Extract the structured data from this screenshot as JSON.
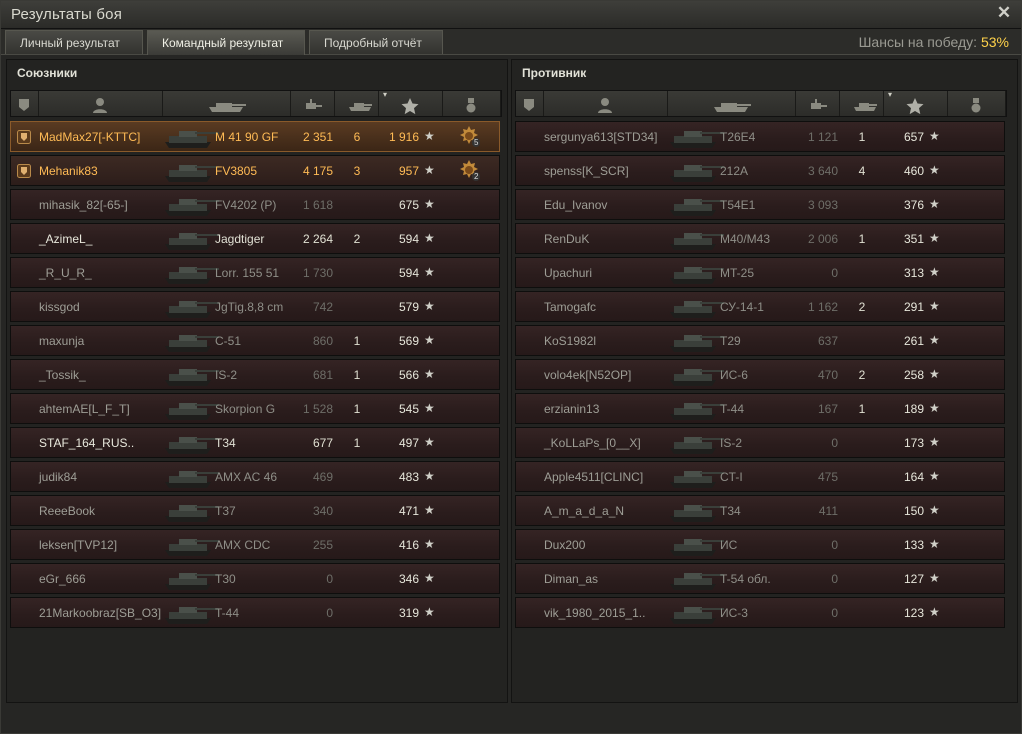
{
  "window": {
    "title": "Результаты боя"
  },
  "tabs": [
    {
      "label": "Личный результат",
      "active": false
    },
    {
      "label": "Командный результат",
      "active": true
    },
    {
      "label": "Подробный отчёт",
      "active": false
    }
  ],
  "win_chance": {
    "label": "Шансы на победу:",
    "value": "53%"
  },
  "allies": {
    "title": "Союзники",
    "rows": [
      {
        "nick": "MadMax27[-KTTC]",
        "vehicle": "M 41 90 GF",
        "damage": "2 351",
        "kills": "6",
        "xp": "1 916",
        "style": "self",
        "platoon": true,
        "medal": "5"
      },
      {
        "nick": "Mehanik83",
        "vehicle": "FV3805",
        "damage": "4 175",
        "kills": "3",
        "xp": "957",
        "style": "squad",
        "platoon": true,
        "medal": "2"
      },
      {
        "nick": "mihasik_82[-65-]",
        "vehicle": "FV4202 (P)",
        "damage": "1 618",
        "kills": "",
        "xp": "675",
        "style": "dead"
      },
      {
        "nick": "_AzimeL_",
        "vehicle": "Jagdtiger",
        "damage": "2 264",
        "kills": "2",
        "xp": "594",
        "style": "alive"
      },
      {
        "nick": "_R_U_R_",
        "vehicle": "Lorr. 155 51",
        "damage": "1 730",
        "kills": "",
        "xp": "594",
        "style": "dead"
      },
      {
        "nick": "kissgod",
        "vehicle": "JgTig.8,8 cm",
        "damage": "742",
        "kills": "",
        "xp": "579",
        "style": "dead"
      },
      {
        "nick": "maxunja",
        "vehicle": "C-51",
        "damage": "860",
        "kills": "1",
        "xp": "569",
        "style": "dead"
      },
      {
        "nick": "_Tossik_",
        "vehicle": "IS-2",
        "damage": "681",
        "kills": "1",
        "xp": "566",
        "style": "dead"
      },
      {
        "nick": "ahtemAE[L_F_T]",
        "vehicle": "Skorpion G",
        "damage": "1 528",
        "kills": "1",
        "xp": "545",
        "style": "dead"
      },
      {
        "nick": "STAF_164_RUS..",
        "vehicle": "T34",
        "damage": "677",
        "kills": "1",
        "xp": "497",
        "style": "alive"
      },
      {
        "nick": "judik84",
        "vehicle": "AMX AC 46",
        "damage": "469",
        "kills": "",
        "xp": "483",
        "style": "dead"
      },
      {
        "nick": "ReeeBook",
        "vehicle": "T37",
        "damage": "340",
        "kills": "",
        "xp": "471",
        "style": "dead"
      },
      {
        "nick": "leksen[TVP12]",
        "vehicle": "AMX CDC",
        "damage": "255",
        "kills": "",
        "xp": "416",
        "style": "dead"
      },
      {
        "nick": "eGr_666",
        "vehicle": "T30",
        "damage": "0",
        "kills": "",
        "xp": "346",
        "style": "dead"
      },
      {
        "nick": "21Markoobraz[SB_O3]",
        "vehicle": "T-44",
        "damage": "0",
        "kills": "",
        "xp": "319",
        "style": "dead"
      }
    ]
  },
  "enemies": {
    "title": "Противник",
    "rows": [
      {
        "nick": "sergunya613[STD34]",
        "vehicle": "T26E4",
        "damage": "1 121",
        "kills": "1",
        "xp": "657",
        "style": "dead"
      },
      {
        "nick": "spenss[K_SCR]",
        "vehicle": "212A",
        "damage": "3 640",
        "kills": "4",
        "xp": "460",
        "style": "dead"
      },
      {
        "nick": "Edu_Ivanov",
        "vehicle": "T54E1",
        "damage": "3 093",
        "kills": "",
        "xp": "376",
        "style": "dead"
      },
      {
        "nick": "RenDuK",
        "vehicle": "M40/M43",
        "damage": "2 006",
        "kills": "1",
        "xp": "351",
        "style": "dead"
      },
      {
        "nick": "Upachuri",
        "vehicle": "MT-25",
        "damage": "0",
        "kills": "",
        "xp": "313",
        "style": "dead"
      },
      {
        "nick": "Tamogafc",
        "vehicle": "СУ-14-1",
        "damage": "1 162",
        "kills": "2",
        "xp": "291",
        "style": "dead"
      },
      {
        "nick": "KoS1982l",
        "vehicle": "T29",
        "damage": "637",
        "kills": "",
        "xp": "261",
        "style": "dead"
      },
      {
        "nick": "volo4ek[N52OP]",
        "vehicle": "ИС-6",
        "damage": "470",
        "kills": "2",
        "xp": "258",
        "style": "dead"
      },
      {
        "nick": "erzianin13",
        "vehicle": "T-44",
        "damage": "167",
        "kills": "1",
        "xp": "189",
        "style": "dead"
      },
      {
        "nick": "_KoLLaPs_[0__X]",
        "vehicle": "IS-2",
        "damage": "0",
        "kills": "",
        "xp": "173",
        "style": "dead"
      },
      {
        "nick": "Apple4511[CLINC]",
        "vehicle": "CT-I",
        "damage": "475",
        "kills": "",
        "xp": "164",
        "style": "dead"
      },
      {
        "nick": "A_m_a_d_a_N",
        "vehicle": "T34",
        "damage": "411",
        "kills": "",
        "xp": "150",
        "style": "dead"
      },
      {
        "nick": "Dux200",
        "vehicle": "ИС",
        "damage": "0",
        "kills": "",
        "xp": "133",
        "style": "dead"
      },
      {
        "nick": "Diman_as",
        "vehicle": "T-54 обл.",
        "damage": "0",
        "kills": "",
        "xp": "127",
        "style": "dead"
      },
      {
        "nick": "vik_1980_2015_1..",
        "vehicle": "ИС-3",
        "damage": "0",
        "kills": "",
        "xp": "123",
        "style": "dead"
      }
    ]
  },
  "colors": {
    "gold": "#ffbb55",
    "win_chance": "#ffd24a"
  },
  "icons": [
    "platoon-icon",
    "player-icon",
    "tank-icon",
    "damage-icon",
    "kills-icon",
    "xp-star-icon",
    "medal-icon",
    "close-icon"
  ]
}
